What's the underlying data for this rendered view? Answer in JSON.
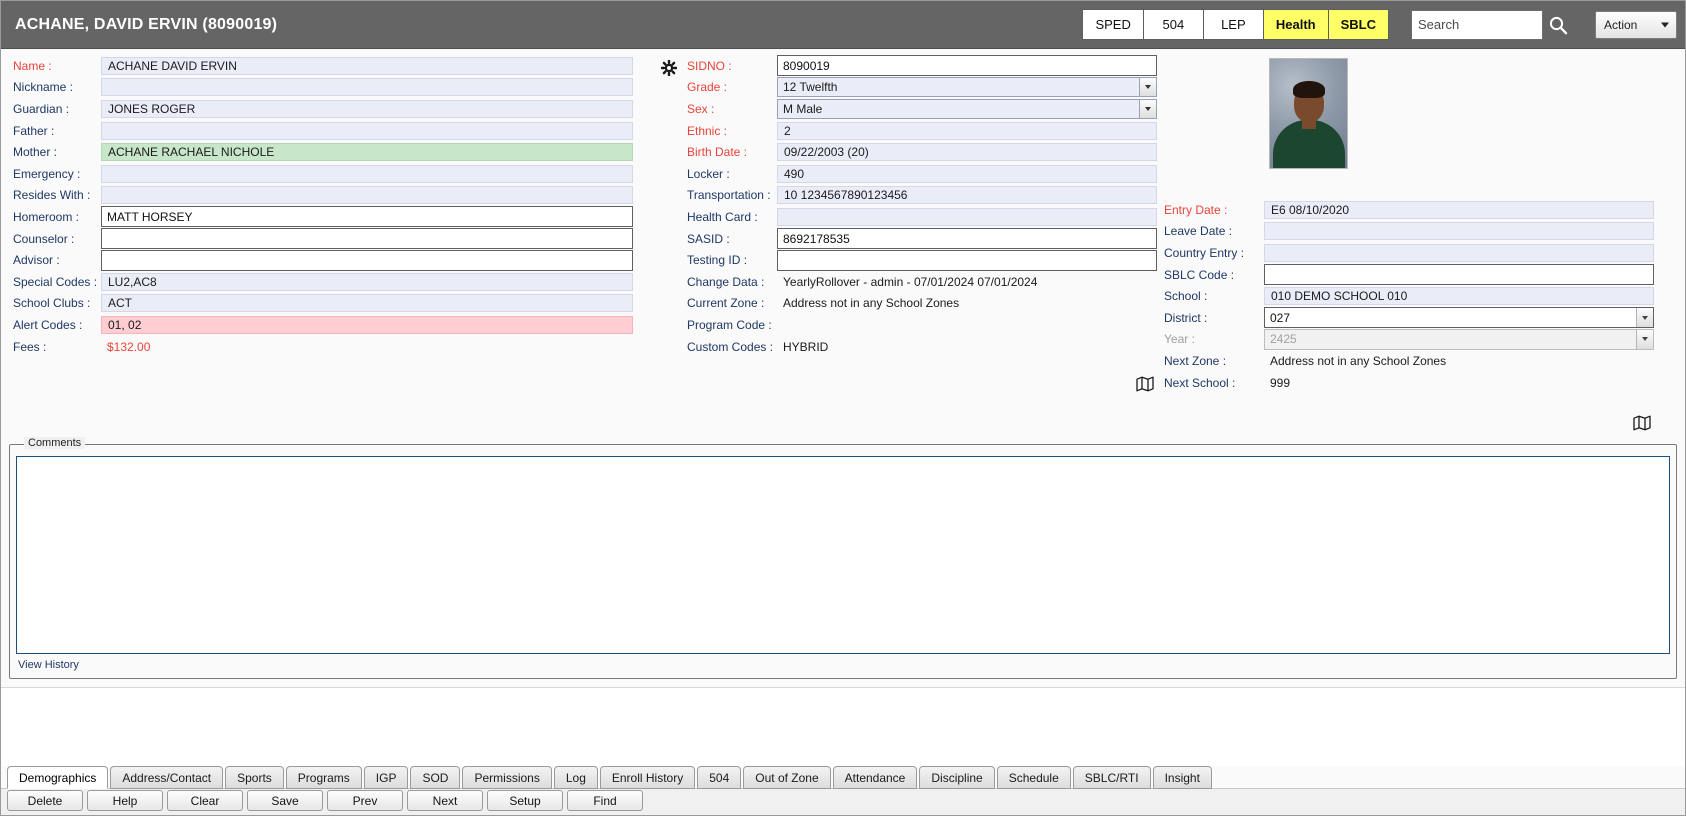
{
  "header": {
    "title": "ACHANE, DAVID ERVIN (8090019)",
    "chips": [
      {
        "label": "SPED",
        "highlight": false
      },
      {
        "label": "504",
        "highlight": false
      },
      {
        "label": "LEP",
        "highlight": false
      },
      {
        "label": "Health",
        "highlight": true
      },
      {
        "label": "SBLC",
        "highlight": true
      }
    ],
    "search_placeholder": "Search",
    "search_value": "",
    "action_label": "Action"
  },
  "left_column": [
    {
      "label": "Name :",
      "value": "ACHANE  DAVID ERVIN",
      "kind": "ro",
      "required": true
    },
    {
      "label": "Nickname :",
      "value": "",
      "kind": "ro",
      "required": false
    },
    {
      "label": "Guardian :",
      "value": "JONES  ROGER",
      "kind": "ro",
      "required": false
    },
    {
      "label": "Father :",
      "value": "",
      "kind": "ro",
      "required": false
    },
    {
      "label": "Mother :",
      "value": "ACHANE  RACHAEL NICHOLE",
      "kind": "green",
      "required": false
    },
    {
      "label": "Emergency :",
      "value": "",
      "kind": "ro",
      "required": false
    },
    {
      "label": "Resides With :",
      "value": "",
      "kind": "ro",
      "required": false
    },
    {
      "label": "Homeroom :",
      "value": "MATT HORSEY",
      "kind": "input",
      "required": false
    },
    {
      "label": "Counselor :",
      "value": "",
      "kind": "input",
      "required": false
    },
    {
      "label": "Advisor :",
      "value": "",
      "kind": "input",
      "required": false
    },
    {
      "label": "Special Codes :",
      "value": "LU2,AC8",
      "kind": "ro",
      "required": false
    },
    {
      "label": "School Clubs :",
      "value": "ACT",
      "kind": "ro",
      "required": false
    },
    {
      "label": "Alert Codes :",
      "value": "01, 02",
      "kind": "pink",
      "required": false
    },
    {
      "label": "Fees :",
      "value": "$132.00",
      "kind": "fee",
      "required": false
    }
  ],
  "middle_column": [
    {
      "label": "SIDNO :",
      "value": "8090019",
      "kind": "input",
      "required": true
    },
    {
      "label": "Grade :",
      "value": "12 Twelfth",
      "kind": "select",
      "required": true
    },
    {
      "label": "Sex :",
      "value": "M Male",
      "kind": "select",
      "required": true
    },
    {
      "label": "Ethnic :",
      "value": "2",
      "kind": "ro",
      "required": true
    },
    {
      "label": "Birth Date :",
      "value": "09/22/2003 (20)",
      "kind": "ro",
      "required": true
    },
    {
      "label": "Locker :",
      "value": "490",
      "kind": "ro",
      "required": false
    },
    {
      "label": "Transportation :",
      "value": "10  1234567890123456",
      "kind": "ro",
      "required": false
    },
    {
      "label": "Health Card :",
      "value": "",
      "kind": "ro",
      "required": false
    },
    {
      "label": "SASID :",
      "value": "8692178535",
      "kind": "input",
      "required": false
    },
    {
      "label": "Testing ID :",
      "value": "",
      "kind": "input",
      "required": false
    },
    {
      "label": "Change Data :",
      "value": "YearlyRollover - admin - 07/01/2024 07/01/2024",
      "kind": "text",
      "required": false
    },
    {
      "label": "Current Zone :",
      "value": "Address not in any School Zones",
      "kind": "text",
      "required": false
    },
    {
      "label": "Program Code :",
      "value": "",
      "kind": "text",
      "required": false
    },
    {
      "label": "Custom Codes :",
      "value": "HYBRID",
      "kind": "text",
      "required": false
    }
  ],
  "right_column": [
    {
      "label": "Entry Date :",
      "value": "E6 08/10/2020",
      "kind": "ro",
      "required": true,
      "disabled": false
    },
    {
      "label": "Leave Date :",
      "value": "",
      "kind": "ro",
      "required": false,
      "disabled": false
    },
    {
      "label": "Country Entry :",
      "value": "",
      "kind": "ro",
      "required": false,
      "disabled": false
    },
    {
      "label": "SBLC Code :",
      "value": "",
      "kind": "input",
      "required": false,
      "disabled": false
    },
    {
      "label": "School :",
      "value": "010     DEMO SCHOOL 010",
      "kind": "ro",
      "required": false,
      "disabled": false
    },
    {
      "label": "District :",
      "value": "027",
      "kind": "select2",
      "required": false,
      "disabled": false
    },
    {
      "label": "Year :",
      "value": "2425",
      "kind": "select2",
      "required": false,
      "disabled": true
    },
    {
      "label": "Next Zone :",
      "value": "Address not in any School Zones",
      "kind": "text",
      "required": false,
      "disabled": false
    },
    {
      "label": "Next School :",
      "value": "999",
      "kind": "text",
      "required": false,
      "disabled": false
    }
  ],
  "comments": {
    "legend": "Comments",
    "body": "",
    "view_history": "View History"
  },
  "tabs": [
    {
      "label": "Demographics",
      "active": true
    },
    {
      "label": "Address/Contact",
      "active": false
    },
    {
      "label": "Sports",
      "active": false
    },
    {
      "label": "Programs",
      "active": false
    },
    {
      "label": "IGP",
      "active": false
    },
    {
      "label": "SOD",
      "active": false
    },
    {
      "label": "Permissions",
      "active": false
    },
    {
      "label": "Log",
      "active": false
    },
    {
      "label": "Enroll History",
      "active": false
    },
    {
      "label": "504",
      "active": false
    },
    {
      "label": "Out of Zone",
      "active": false
    },
    {
      "label": "Attendance",
      "active": false
    },
    {
      "label": "Discipline",
      "active": false
    },
    {
      "label": "Schedule",
      "active": false
    },
    {
      "label": "SBLC/RTI",
      "active": false
    },
    {
      "label": "Insight",
      "active": false
    }
  ],
  "buttons": [
    "Delete",
    "Help",
    "Clear",
    "Save",
    "Prev",
    "Next",
    "Setup",
    "Find"
  ],
  "icons": {
    "gear": "gear-icon",
    "search": "search-icon",
    "map_current": "map-icon",
    "map_next": "map-icon"
  },
  "colors": {
    "header_bg": "#656565",
    "chip_highlight": "#ffff66",
    "required_label": "#e8433a",
    "label": "#1f3864",
    "readonly_field": "#eaedf8",
    "green_field": "#c8e6c9",
    "pink_field": "#ffcdd2",
    "comments_border": "#1f4e79"
  }
}
